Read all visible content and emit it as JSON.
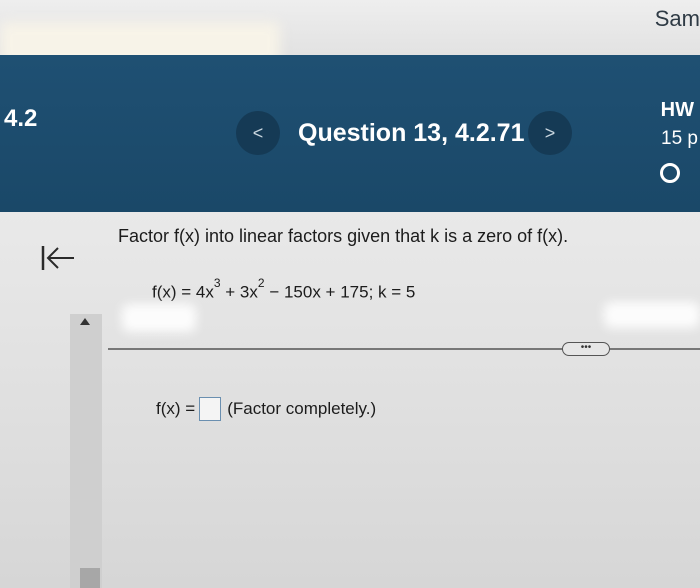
{
  "topbar": {
    "user_name": "Sam"
  },
  "header": {
    "section_number": "4.2",
    "question_title": "Question 13, 4.2.71",
    "prev_label": "<",
    "next_label": ">",
    "hw_label": "HW",
    "points_label": "15 p"
  },
  "question": {
    "prompt": "Factor f(x) into linear factors given that k is a zero of f(x).",
    "equation": {
      "lhs": "f(x) = 4x",
      "exp1": "3",
      "term2": " + 3x",
      "exp2": "2",
      "rest": " − 150x + 175; k = 5"
    },
    "answer_lhs": "f(x) =",
    "answer_hint": "(Factor completely.)",
    "more_label": "•••"
  },
  "colors": {
    "header": "#1f5073",
    "header_button": "#153a55",
    "answer_box_border": "#6a8fb0"
  }
}
